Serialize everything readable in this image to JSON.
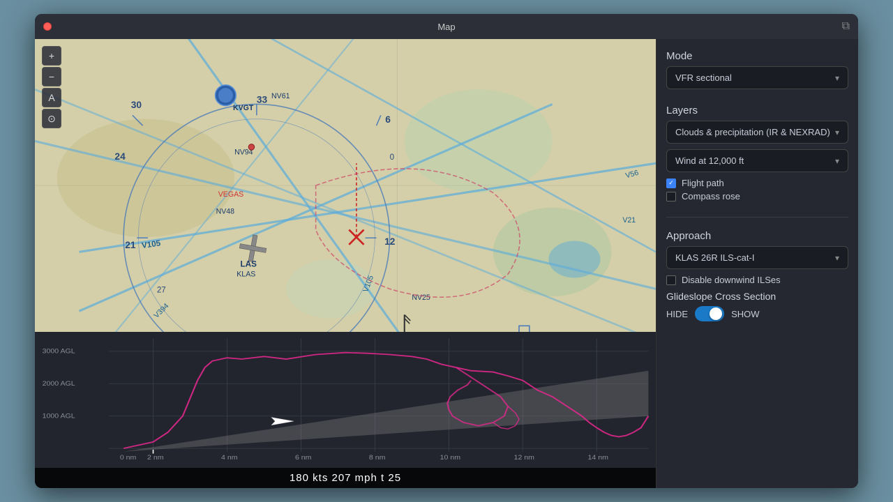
{
  "window": {
    "title": "Map"
  },
  "status_bar": {
    "text": "180 kts   207 mph   t 25"
  },
  "mode_section": {
    "label": "Mode",
    "dropdown_value": "VFR sectional"
  },
  "layers_section": {
    "label": "Layers",
    "dropdown1_value": "Clouds & precipitation (IR & NEXRAD)",
    "dropdown2_value": "Wind at 12,000 ft",
    "checkbox_flight_path": {
      "label": "Flight path",
      "checked": true
    },
    "checkbox_compass_rose": {
      "label": "Compass rose",
      "checked": false
    }
  },
  "approach_section": {
    "label": "Approach",
    "dropdown_value": "KLAS 26R ILS-cat-I",
    "checkbox_disable_ils": {
      "label": "Disable downwind ILSes",
      "checked": false
    },
    "glideslope_label": "Glideslope Cross Section",
    "toggle_hide": "HIDE",
    "toggle_show": "SHOW",
    "toggle_state": "show"
  },
  "map_toolbar": {
    "zoom_in": "+",
    "zoom_out": "−",
    "label_btn": "A",
    "locate_btn": "⊙"
  },
  "profile": {
    "y_labels": [
      "3000 AGL",
      "2000 AGL",
      "1000 AGL"
    ],
    "x_labels": [
      "0 nm",
      "2 nm",
      "4 nm",
      "6 nm",
      "8 nm",
      "10 nm",
      "12 nm",
      "14 nm"
    ]
  }
}
